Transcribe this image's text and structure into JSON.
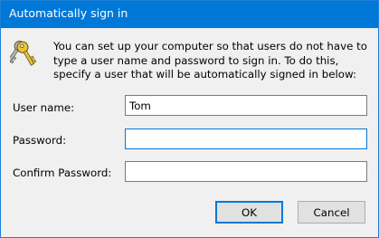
{
  "window": {
    "title": "Automatically sign in"
  },
  "header": {
    "icon": "keys-icon",
    "description": "You can set up your computer so that users do not have to type a user name and password to sign in. To do this, specify a user that will be automatically signed in below:"
  },
  "form": {
    "username_label": "User name:",
    "username_value": "Tom",
    "password_label": "Password:",
    "password_value": "",
    "confirm_label": "Confirm Password:",
    "confirm_value": ""
  },
  "buttons": {
    "ok_label": "OK",
    "cancel_label": "Cancel"
  },
  "colors": {
    "accent": "#0078d7",
    "dialog_background": "#f0f0f0",
    "button_background": "#e1e1e1"
  }
}
